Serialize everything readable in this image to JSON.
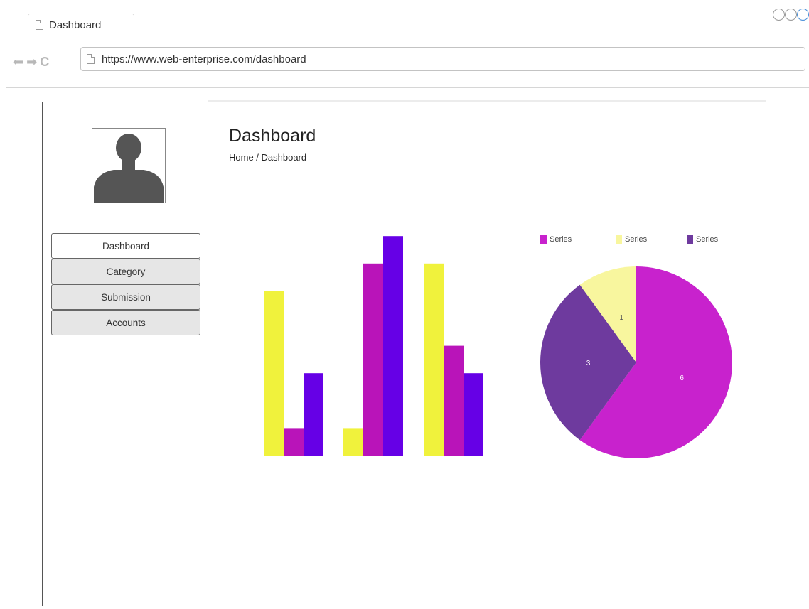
{
  "browser": {
    "tab_title": "Dashboard",
    "url": "https://www.web-enterprise.com/dashboard"
  },
  "sidebar": {
    "items": [
      {
        "label": "Dashboard",
        "active": true
      },
      {
        "label": "Category",
        "active": false
      },
      {
        "label": "Submission",
        "active": false
      },
      {
        "label": "Accounts",
        "active": false
      }
    ]
  },
  "main": {
    "title": "Dashboard",
    "breadcrumb": "Home / Dashboard"
  },
  "colors": {
    "yellow": "#f0f23c",
    "magenta": "#b914b9",
    "violet": "#6600e6",
    "pie_magenta": "#c822cd",
    "pie_yellow": "#f8f69e",
    "pie_purple": "#6e3a9e"
  },
  "chart_data": [
    {
      "type": "bar",
      "categories": [
        "",
        "",
        ""
      ],
      "series": [
        {
          "color": "#f0f23c",
          "values": [
            6,
            1,
            7
          ]
        },
        {
          "color": "#b914b9",
          "values": [
            1,
            7,
            4
          ]
        },
        {
          "color": "#6600e6",
          "values": [
            3,
            8,
            3
          ]
        }
      ],
      "ylim": [
        0,
        8
      ],
      "grid": false
    },
    {
      "type": "pie",
      "legend": [
        "Series",
        "Series",
        "Series"
      ],
      "legend_colors": [
        "#c822cd",
        "#f8f69e",
        "#6e3a9e"
      ],
      "legend_position": "top",
      "slices": [
        {
          "value": 6,
          "label": "6",
          "color": "#c822cd"
        },
        {
          "value": 3,
          "label": "3",
          "color": "#6e3a9e"
        },
        {
          "value": 1,
          "label": "1",
          "color": "#f8f69e"
        }
      ]
    }
  ]
}
